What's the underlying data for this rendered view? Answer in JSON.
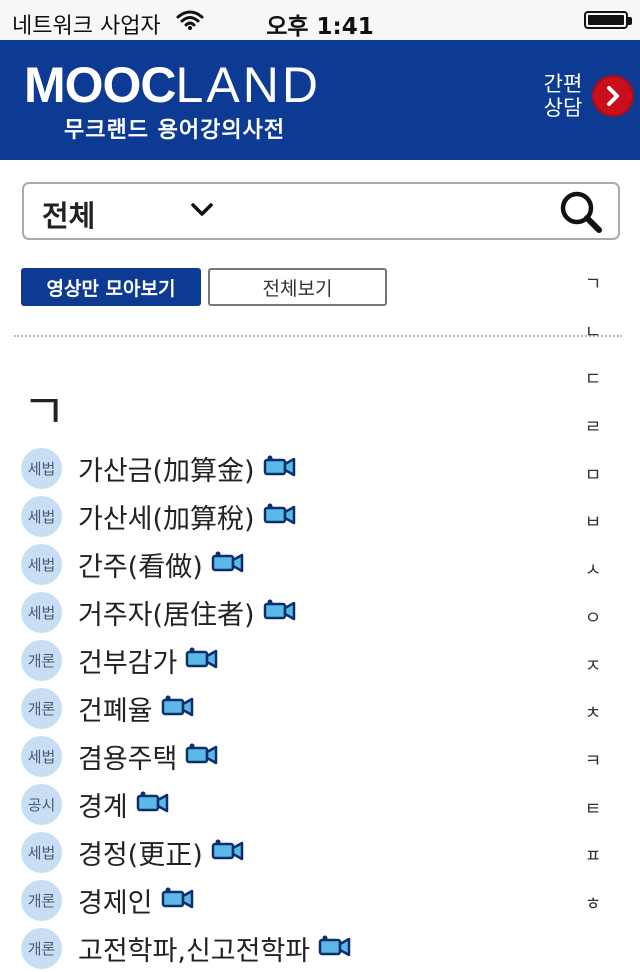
{
  "status_bar": {
    "carrier": "네트워크 사업자",
    "time": "오후 1:41",
    "battery_level": 1.0
  },
  "header": {
    "logo_main_a": "MOOC",
    "logo_main_b": "LAND",
    "logo_sub": "무크랜드 용어강의사전",
    "consult_line1": "간편",
    "consult_line2": "상담"
  },
  "search": {
    "category": "전체"
  },
  "filters": {
    "video_only": "영상만 모아보기",
    "view_all": "전체보기"
  },
  "section": {
    "letter": "ㄱ"
  },
  "terms": [
    {
      "badge": "세법",
      "label": "가산금(加算金)"
    },
    {
      "badge": "세법",
      "label": "가산세(加算稅)"
    },
    {
      "badge": "세법",
      "label": "간주(看做)"
    },
    {
      "badge": "세법",
      "label": "거주자(居住者)"
    },
    {
      "badge": "개론",
      "label": "건부감가"
    },
    {
      "badge": "개론",
      "label": "건폐율"
    },
    {
      "badge": "세법",
      "label": "겸용주택"
    },
    {
      "badge": "공시",
      "label": "경계"
    },
    {
      "badge": "세법",
      "label": "경정(更正)"
    },
    {
      "badge": "개론",
      "label": "경제인"
    },
    {
      "badge": "개론",
      "label": "고전학파,신고전학파"
    }
  ],
  "alphabet_index": [
    "ㄱ",
    "ㄴ",
    "ㄷ",
    "ㄹ",
    "ㅁ",
    "ㅂ",
    "ㅅ",
    "ㅇ",
    "ㅈ",
    "ㅊ",
    "ㅋ",
    "ㅌ",
    "ㅍ",
    "ㅎ"
  ],
  "colors": {
    "brand_blue": "#0d3a93",
    "consult_red": "#c8101a",
    "badge_bg": "#c8def5",
    "camera_icon": "#5cb8e6"
  },
  "icons": {
    "wifi": "wifi-icon",
    "battery": "battery-icon",
    "consult": "chevron-right-icon",
    "dropdown": "chevron-down-icon",
    "search": "search-icon",
    "video": "video-camera-icon"
  }
}
